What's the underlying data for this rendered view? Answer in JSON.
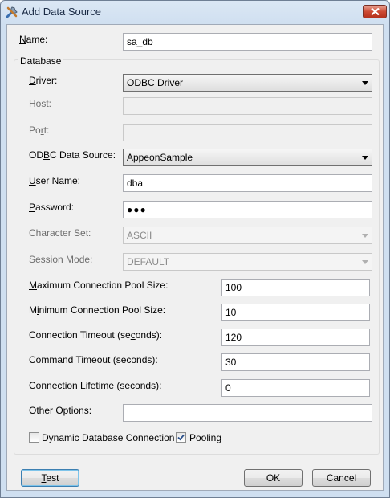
{
  "window": {
    "title": "Add Data Source"
  },
  "name": {
    "label_pre": "",
    "label_u": "N",
    "label_post": "ame:",
    "value": "sa_db"
  },
  "database": {
    "group_label": "Database",
    "driver": {
      "label_pre": "",
      "label_u": "D",
      "label_post": "river:",
      "value": "ODBC Driver"
    },
    "host": {
      "label_pre": "",
      "label_u": "H",
      "label_post": "ost:",
      "value": ""
    },
    "port": {
      "label_pre": "Po",
      "label_u": "r",
      "label_post": "t:",
      "value": ""
    },
    "odbc_source": {
      "label_pre": "OD",
      "label_u": "B",
      "label_post": "C Data Source:",
      "value": "AppeonSample"
    },
    "user_name": {
      "label_pre": "",
      "label_u": "U",
      "label_post": "ser Name:",
      "value": "dba"
    },
    "password": {
      "label_pre": "",
      "label_u": "P",
      "label_post": "assword:",
      "value": "●●●"
    },
    "character_set": {
      "label": "Character Set:",
      "value": "ASCII"
    },
    "session_mode": {
      "label": "Session Mode:",
      "value": "DEFAULT"
    },
    "max_pool": {
      "label_pre": "",
      "label_u": "M",
      "label_post": "aximum Connection Pool Size:",
      "value": "100"
    },
    "min_pool": {
      "label_pre": "M",
      "label_u": "i",
      "label_post": "nimum Connection Pool Size:",
      "value": "10"
    },
    "conn_timeout": {
      "label_pre": "Connection Timeout (se",
      "label_u": "c",
      "label_post": "onds):",
      "value": "120"
    },
    "cmd_timeout": {
      "label": "Command Timeout (seconds):",
      "value": "30"
    },
    "conn_lifetime": {
      "label": "Connection Lifetime (seconds):",
      "value": "0"
    },
    "other_options": {
      "label": "Other Options:",
      "value": ""
    },
    "dynamic_connection": {
      "label": "Dynamic Database Connection",
      "checked": false
    },
    "pooling": {
      "label": "Pooling",
      "checked": true
    }
  },
  "buttons": {
    "test": {
      "label_pre": "",
      "label_u": "T",
      "label_post": "est"
    },
    "ok": "OK",
    "cancel": "Cancel"
  },
  "icons": {
    "app": "tools-icon",
    "close": "close-icon",
    "dropdown": "chevron-down-icon",
    "check": "check-icon"
  }
}
